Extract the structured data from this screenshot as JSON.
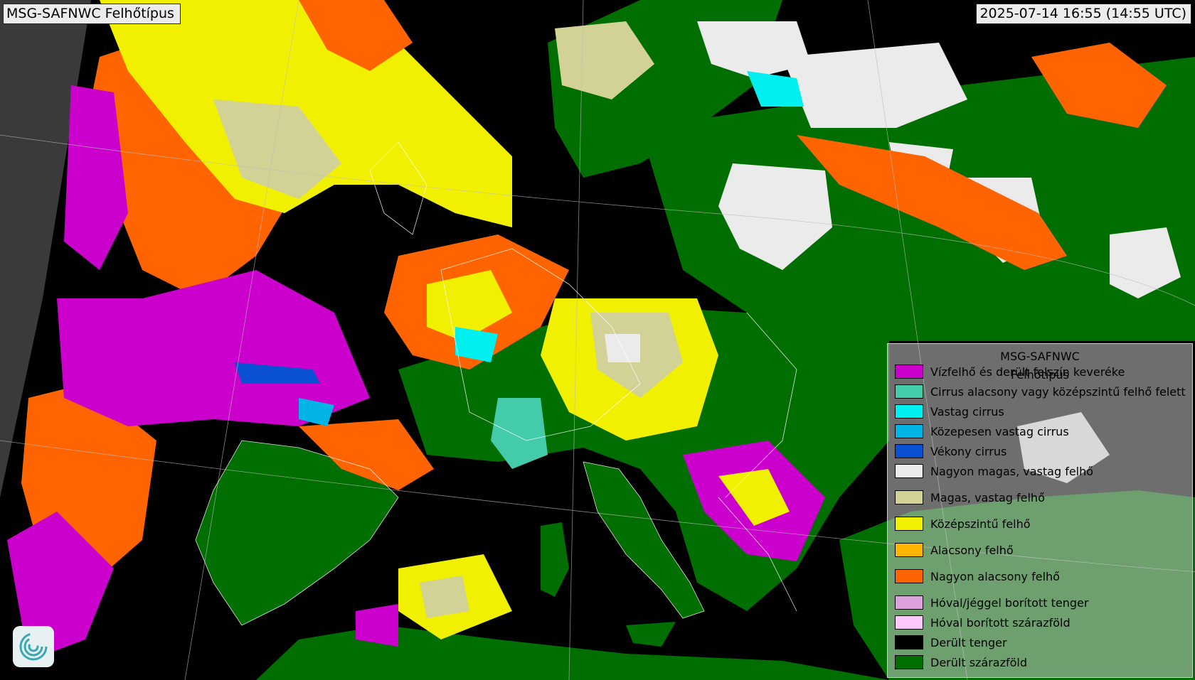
{
  "header": {
    "title": "MSG-SAFNWC Felhőtípus",
    "timestamp": "2025-07-14 16:55 (14:55 UTC)"
  },
  "legend": {
    "title_line1": "MSG-SAFNWC",
    "title_line2": "Felhőtípus",
    "items": [
      {
        "label": "Vízfelhő és derült felszín keveréke",
        "color": "#cc00cc"
      },
      {
        "label": "Cirrus alacsony vagy középszintű felhő felett",
        "color": "#44ccaa"
      },
      {
        "label": "Vastag cirrus",
        "color": "#00f0f0"
      },
      {
        "label": "Közepesen vastag cirrus",
        "color": "#00b4e6"
      },
      {
        "label": "Vékony cirrus",
        "color": "#0a50d2"
      },
      {
        "label": "Nagyon magas, vastag felhő",
        "color": "#ebebeb"
      },
      {
        "label": "Magas, vastag felhő",
        "color": "#d2d296"
      },
      {
        "label": "Középszintű felhő",
        "color": "#f0f000"
      },
      {
        "label": "Alacsony felhő",
        "color": "#ffb400"
      },
      {
        "label": "Nagyon alacsony felhő",
        "color": "#ff6400"
      },
      {
        "label": "Hóval/jéggel borított tenger",
        "color": "#dca0dc"
      },
      {
        "label": "Hóval borított szárazföld",
        "color": "#ffc8ff"
      },
      {
        "label": "Derült tenger",
        "color": "#000000"
      },
      {
        "label": "Derült szárazföld",
        "color": "#006e00"
      }
    ]
  },
  "map": {
    "background": "#3a3a3a",
    "logo_icon": "swirl-logo-icon"
  }
}
